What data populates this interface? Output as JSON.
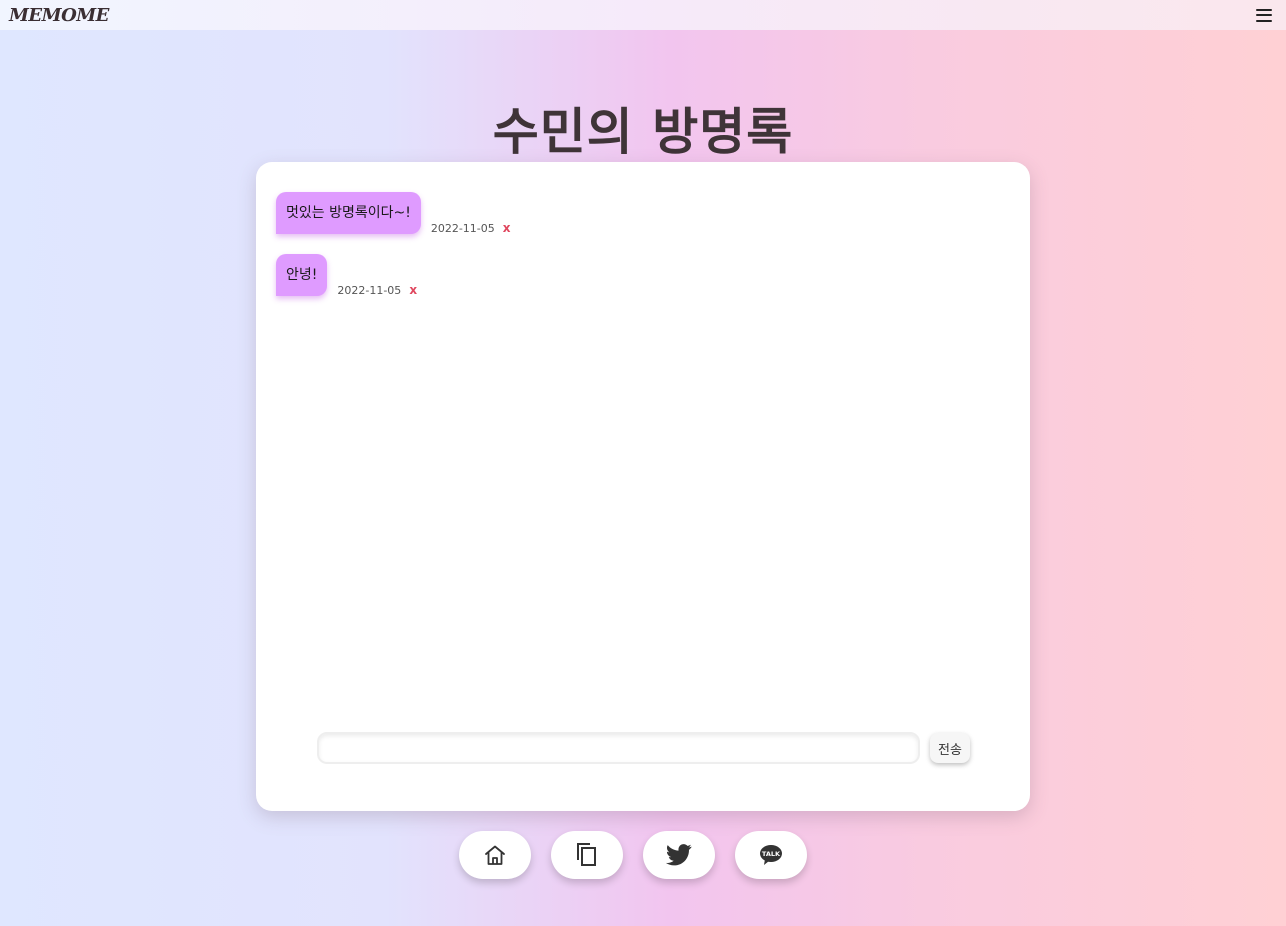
{
  "header": {
    "logo": "MEMOME",
    "menu_icon": "hamburger-menu-icon"
  },
  "page_title": "수민의 방명록",
  "messages": [
    {
      "text": "멋있는 방명록이다~!",
      "date": "2022-11-05",
      "delete_label": "x"
    },
    {
      "text": "안녕!",
      "date": "2022-11-05",
      "delete_label": "x"
    }
  ],
  "composer": {
    "input_value": "",
    "input_placeholder": "",
    "send_label": "전송"
  },
  "bottom_nav": [
    {
      "icon": "home-icon"
    },
    {
      "icon": "copy-icon"
    },
    {
      "icon": "twitter-icon"
    },
    {
      "icon": "kakaotalk-icon",
      "icon_text": "TALK"
    }
  ],
  "colors": {
    "bubble": "#df9bff",
    "delete": "#e0485f",
    "title": "#3f3438"
  }
}
